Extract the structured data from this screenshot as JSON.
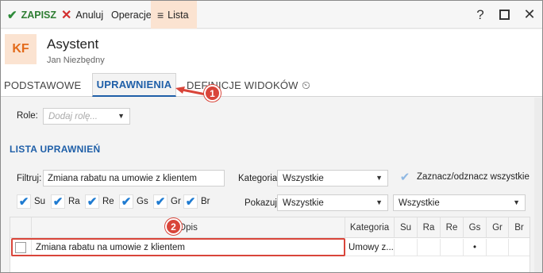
{
  "toolbar": {
    "save_label": "ZAPISZ",
    "cancel_label": "Anuluj",
    "operations_label": "Operacje",
    "list_label": "Lista",
    "help_glyph": "?",
    "close_glyph": "✕"
  },
  "header": {
    "badge": "KF",
    "title": "Asystent",
    "subtitle": "Jan Niezbędny"
  },
  "tabs": [
    {
      "label": "PODSTAWOWE"
    },
    {
      "label": "UPRAWNIENIA"
    },
    {
      "label": "DEFINICJE WIDOKÓW"
    }
  ],
  "callouts": [
    "1",
    "2"
  ],
  "roles": {
    "label": "Role:",
    "placeholder": "Dodaj rolę..."
  },
  "section_title": "LISTA UPRAWNIEŃ",
  "filter": {
    "label": "Filtruj:",
    "value": "Zmiana rabatu na umowie z klientem"
  },
  "category": {
    "label": "Kategoria:",
    "value": "Wszystkie"
  },
  "toggle_all_label": "Zaznacz/odznacz wszystkie",
  "show": {
    "label": "Pokazuj:",
    "value": "Wszystkie",
    "second_value": "Wszystkie"
  },
  "permission_checks": [
    "Su",
    "Ra",
    "Re",
    "Gs",
    "Gr",
    "Br"
  ],
  "grid": {
    "columns": [
      "Opis",
      "Kategoria",
      "Su",
      "Ra",
      "Re",
      "Gs",
      "Gr",
      "Br"
    ],
    "rows": [
      {
        "opis": "Zmiana rabatu na umowie z klientem",
        "kategoria": "Umowy z...",
        "gs": "•"
      }
    ]
  },
  "colors": {
    "accent": "#1f5fa8",
    "badge_bg": "#fbe3d1",
    "badge_text": "#e36a1a",
    "callout": "#d9453a",
    "save_green": "#2e7d32"
  }
}
